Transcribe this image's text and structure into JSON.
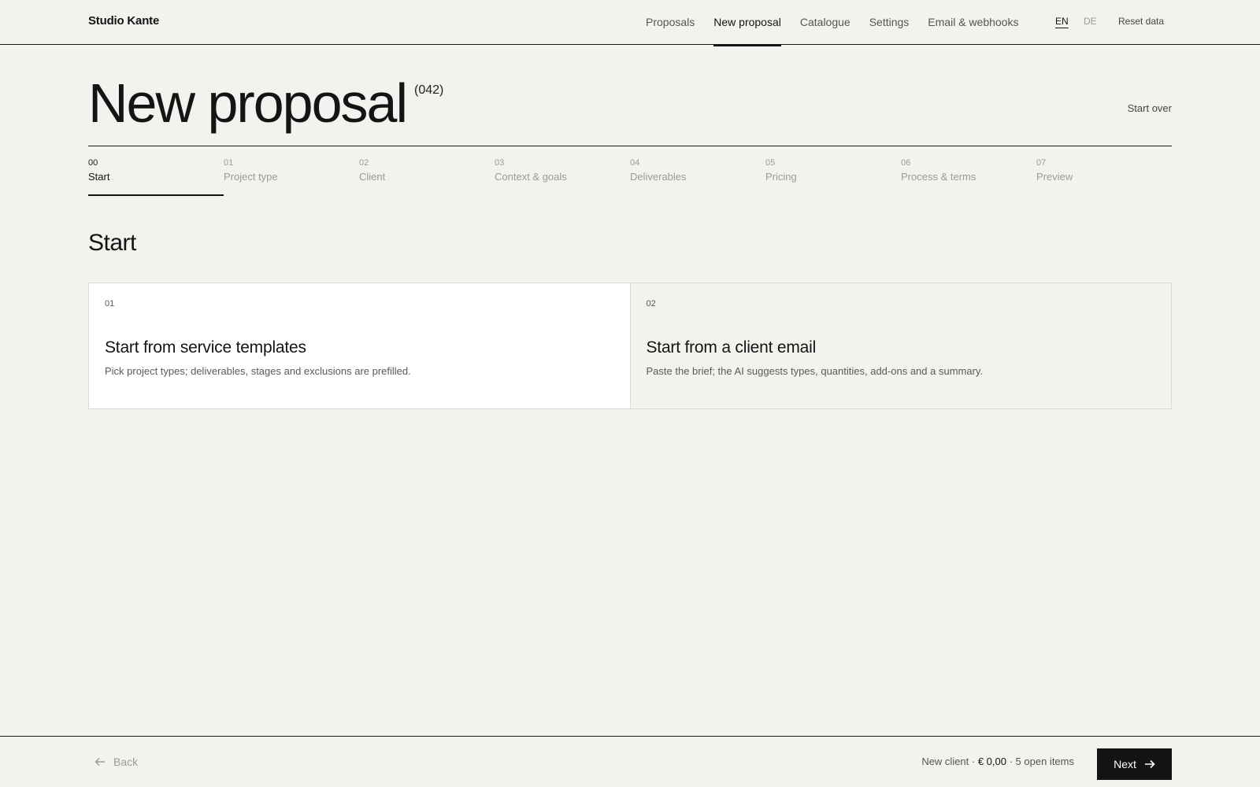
{
  "brand": "Studio Kante",
  "nav": {
    "items": [
      {
        "label": "Proposals"
      },
      {
        "label": "New proposal"
      },
      {
        "label": "Catalogue"
      },
      {
        "label": "Settings"
      },
      {
        "label": "Email & webhooks"
      }
    ],
    "active": "New proposal",
    "languages": {
      "en": "EN",
      "de": "DE",
      "active": "EN"
    },
    "reset_label": "Reset data"
  },
  "header": {
    "title": "New proposal",
    "number": "(042)",
    "start_over_label": "Start over"
  },
  "steps": [
    {
      "num": "00",
      "label": "Start"
    },
    {
      "num": "01",
      "label": "Project type"
    },
    {
      "num": "02",
      "label": "Client"
    },
    {
      "num": "03",
      "label": "Context & goals"
    },
    {
      "num": "04",
      "label": "Deliverables"
    },
    {
      "num": "05",
      "label": "Pricing"
    },
    {
      "num": "06",
      "label": "Process & terms"
    },
    {
      "num": "07",
      "label": "Preview"
    }
  ],
  "active_step": "Start",
  "section": {
    "title": "Start"
  },
  "options": [
    {
      "num": "01",
      "title": "Start from service templates",
      "desc": "Pick project types; deliverables, stages and exclusions are prefilled."
    },
    {
      "num": "02",
      "title": "Start from a client email",
      "desc": "Paste the brief; the AI suggests types, quantities, add-ons and a summary."
    }
  ],
  "footer": {
    "back_label": "Back",
    "summary_prefix": "New client · ",
    "summary_amount": "€ 0,00",
    "summary_suffix": " · 5 open items",
    "next_label": "Next"
  },
  "icons": {
    "back": "arrow-left-icon",
    "next": "arrow-right-icon"
  },
  "colors": {
    "background": "#f4f2ee",
    "ink": "#141414",
    "muted": "#9a9a9a",
    "card_selected": "#ffffff"
  }
}
